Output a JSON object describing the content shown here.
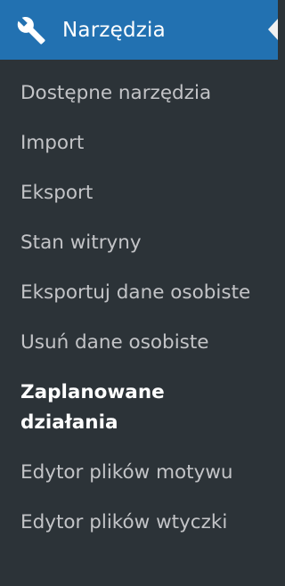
{
  "menu": {
    "title": "Narzędzia",
    "icon": "wrench-icon",
    "header_color": "#2271b1",
    "background_color": "#2c3338",
    "items": [
      {
        "label": "Dostępne narzędzia",
        "active": false
      },
      {
        "label": "Import",
        "active": false
      },
      {
        "label": "Eksport",
        "active": false
      },
      {
        "label": "Stan witryny",
        "active": false
      },
      {
        "label": "Eksportuj dane osobiste",
        "active": false
      },
      {
        "label": "Usuń dane osobiste",
        "active": false
      },
      {
        "label": "Zaplanowane działania",
        "active": true
      },
      {
        "label": "Edytor plików motywu",
        "active": false
      },
      {
        "label": "Edytor plików wtyczki",
        "active": false
      }
    ]
  }
}
